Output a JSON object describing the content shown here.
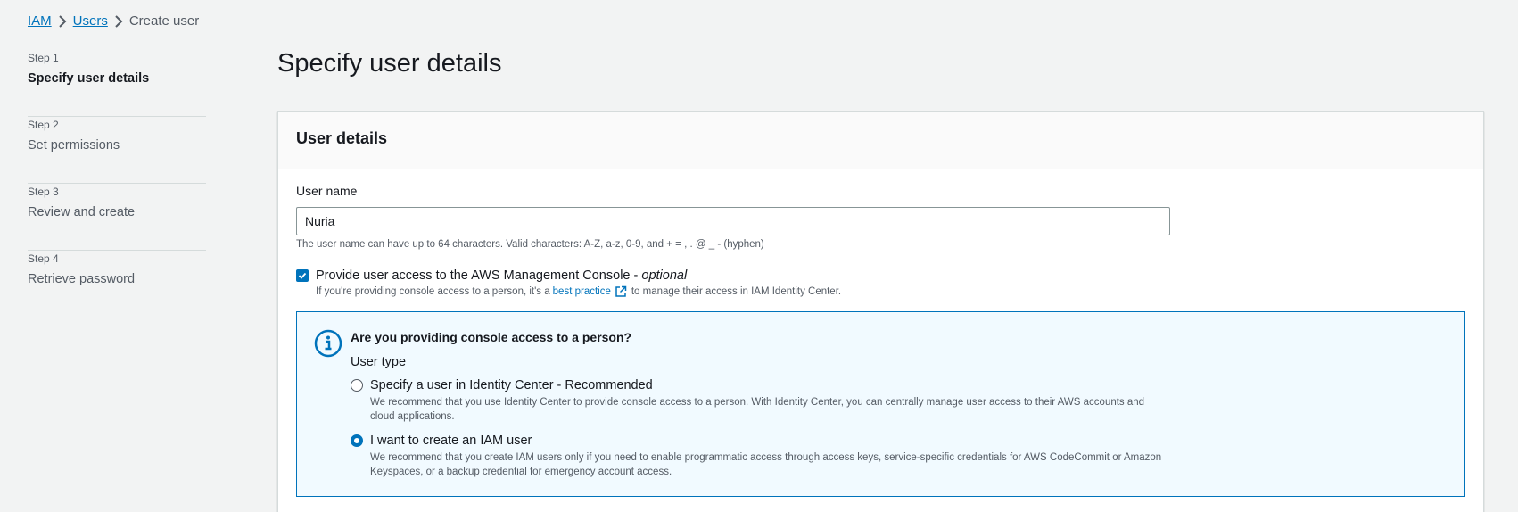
{
  "breadcrumb": {
    "items": [
      "IAM",
      "Users"
    ],
    "current": "Create user"
  },
  "steps": [
    {
      "num": "Step 1",
      "title": "Specify user details"
    },
    {
      "num": "Step 2",
      "title": "Set permissions"
    },
    {
      "num": "Step 3",
      "title": "Review and create"
    },
    {
      "num": "Step 4",
      "title": "Retrieve password"
    }
  ],
  "page": {
    "title": "Specify user details"
  },
  "user_details": {
    "heading": "User details",
    "user_name_label": "User name",
    "user_name_value": "Nuria",
    "user_name_hint": "The user name can have up to 64 characters. Valid characters: A-Z, a-z, 0-9, and + = , . @ _ - (hyphen)",
    "console_access_label": "Provide user access to the AWS Management Console - ",
    "console_access_optional": "optional",
    "console_access_desc_pre": "If you're providing console access to a person, it's a",
    "console_access_link": "best practice",
    "console_access_desc_post": "to manage their access in IAM Identity Center."
  },
  "info": {
    "heading": "Are you providing console access to a person?",
    "user_type_label": "User type",
    "options": [
      {
        "label": "Specify a user in Identity Center - Recommended",
        "desc": "We recommend that you use Identity Center to provide console access to a person. With Identity Center, you can centrally manage user access to their AWS accounts and cloud applications."
      },
      {
        "label": "I want to create an IAM user",
        "desc": "We recommend that you create IAM users only if you need to enable programmatic access through access keys, service-specific credentials for AWS CodeCommit or Amazon Keyspaces, or a backup credential for emergency account access."
      }
    ],
    "selected_index": 1
  },
  "colors": {
    "link": "#0073bb",
    "info_bg": "#f1faff",
    "page_bg": "#f2f3f3"
  }
}
